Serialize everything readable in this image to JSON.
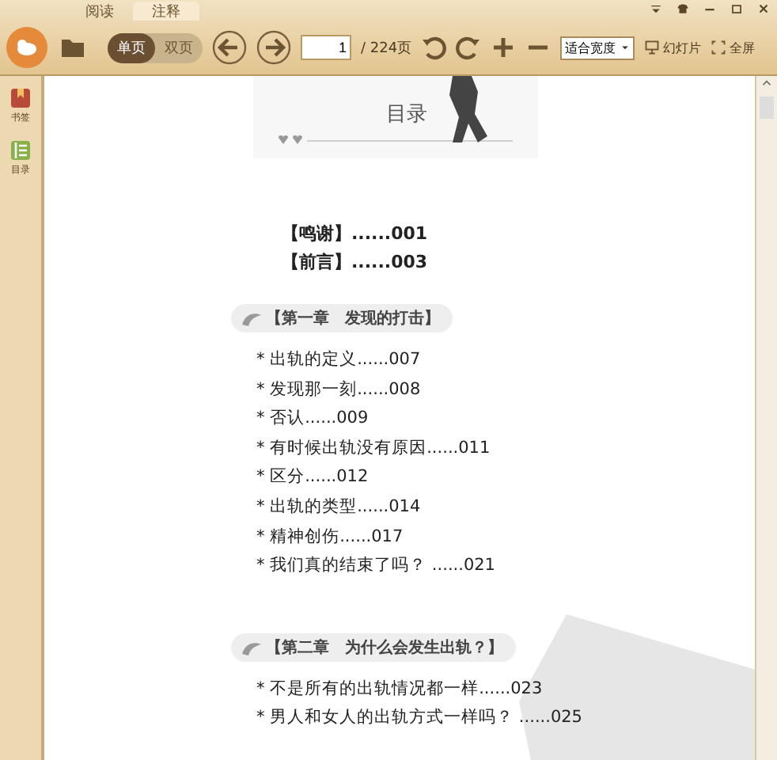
{
  "tabs": [
    {
      "label": "阅读",
      "selected": false
    },
    {
      "label": "注释",
      "selected": true
    }
  ],
  "toolbar": {
    "view_modes": [
      {
        "label": "单页",
        "selected": true
      },
      {
        "label": "双页",
        "selected": false
      }
    ],
    "page_number": "1",
    "page_total": "/ 224页",
    "zoom_mode": "适合宽度",
    "slideshow": "幻灯片",
    "fullscreen": "全屏"
  },
  "sidebar": {
    "items": [
      {
        "label": "书签",
        "kind": "bookmark"
      },
      {
        "label": "目录",
        "kind": "toc"
      }
    ]
  },
  "page": {
    "title": "目录",
    "front_matter": [
      "【鸣谢】......001",
      "【前言】......003"
    ],
    "chapters": [
      {
        "title": "【第一章　发现的打击】",
        "entries": [
          "* 出轨的定义......007",
          "* 发现那一刻......008",
          "* 否认......009",
          "* 有时候出轨没有原因......011",
          "* 区分......012",
          "* 出轨的类型......014",
          "* 精神创伤......017",
          "* 我们真的结束了吗？ ......021"
        ]
      },
      {
        "title": "【第二章　为什么会发生出轨？】",
        "entries": [
          "* 不是所有的出轨情况都一样......023",
          "* 男人和女人的出轨方式一样吗？ ......025"
        ]
      }
    ]
  }
}
